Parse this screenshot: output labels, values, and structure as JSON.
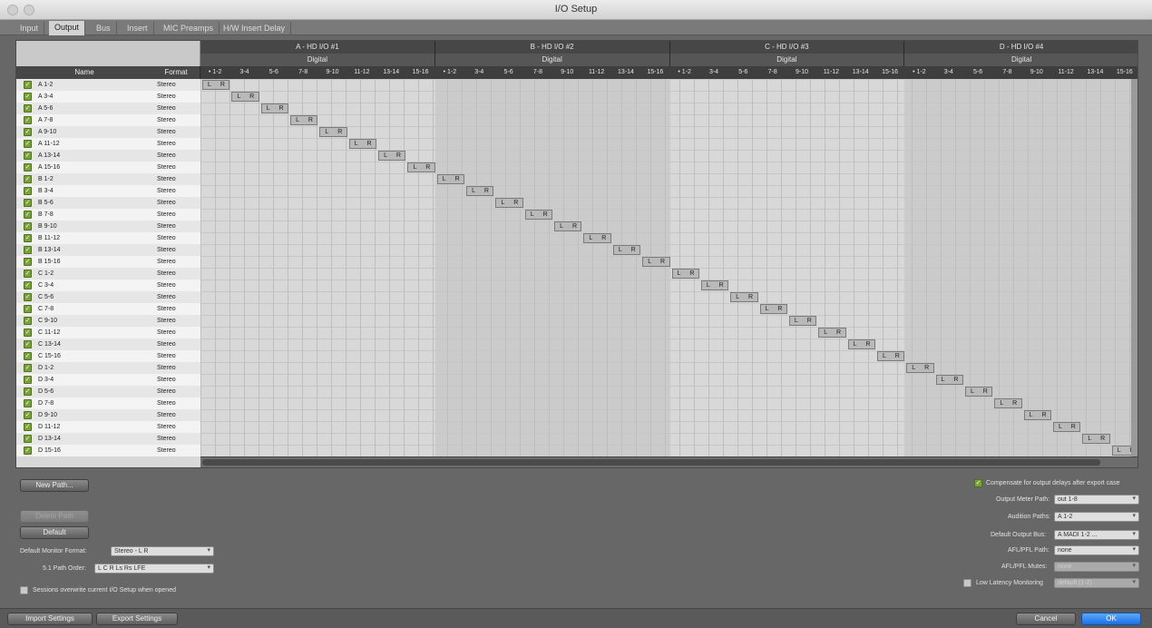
{
  "window": {
    "title": "I/O Setup"
  },
  "tabs": [
    {
      "label": "Input",
      "active": false
    },
    {
      "label": "Output",
      "active": true
    },
    {
      "label": "Bus",
      "active": false
    },
    {
      "label": "Insert",
      "active": false
    },
    {
      "label": "MIC Preamps",
      "active": false
    },
    {
      "label": "H/W Insert Delay",
      "active": false
    }
  ],
  "table": {
    "name_header": "Name",
    "format_header": "Format",
    "groups": [
      {
        "device": "A - HD I/O #1",
        "type": "Digital",
        "channels": [
          "• 1-2",
          "3-4",
          "5-6",
          "7-8",
          "9-10",
          "11-12",
          "13-14",
          "15-16"
        ]
      },
      {
        "device": "B - HD I/O #2",
        "type": "Digital",
        "channels": [
          "• 1-2",
          "3-4",
          "5-6",
          "7-8",
          "9-10",
          "11-12",
          "13-14",
          "15-16"
        ]
      },
      {
        "device": "C - HD I/O #3",
        "type": "Digital",
        "channels": [
          "• 1-2",
          "3-4",
          "5-6",
          "7-8",
          "9-10",
          "11-12",
          "13-14",
          "15-16"
        ]
      },
      {
        "device": "D - HD I/O #4",
        "type": "Digital",
        "channels": [
          "• 1-2",
          "3-4",
          "5-6",
          "7-8",
          "9-10",
          "11-12",
          "13-14",
          "15-16"
        ]
      }
    ],
    "rows": [
      {
        "name": "A 1-2",
        "format": "Stereo"
      },
      {
        "name": "A 3-4",
        "format": "Stereo"
      },
      {
        "name": "A 5-6",
        "format": "Stereo"
      },
      {
        "name": "A 7-8",
        "format": "Stereo"
      },
      {
        "name": "A 9-10",
        "format": "Stereo"
      },
      {
        "name": "A 11-12",
        "format": "Stereo"
      },
      {
        "name": "A 13-14",
        "format": "Stereo"
      },
      {
        "name": "A 15-16",
        "format": "Stereo"
      },
      {
        "name": "B 1-2",
        "format": "Stereo"
      },
      {
        "name": "B 3-4",
        "format": "Stereo"
      },
      {
        "name": "B 5-6",
        "format": "Stereo"
      },
      {
        "name": "B 7-8",
        "format": "Stereo"
      },
      {
        "name": "B 9-10",
        "format": "Stereo"
      },
      {
        "name": "B 11-12",
        "format": "Stereo"
      },
      {
        "name": "B 13-14",
        "format": "Stereo"
      },
      {
        "name": "B 15-16",
        "format": "Stereo"
      },
      {
        "name": "C 1-2",
        "format": "Stereo"
      },
      {
        "name": "C 3-4",
        "format": "Stereo"
      },
      {
        "name": "C 5-6",
        "format": "Stereo"
      },
      {
        "name": "C 7-8",
        "format": "Stereo"
      },
      {
        "name": "C 9-10",
        "format": "Stereo"
      },
      {
        "name": "C 11-12",
        "format": "Stereo"
      },
      {
        "name": "C 13-14",
        "format": "Stereo"
      },
      {
        "name": "C 15-16",
        "format": "Stereo"
      },
      {
        "name": "D 1-2",
        "format": "Stereo"
      },
      {
        "name": "D 3-4",
        "format": "Stereo"
      },
      {
        "name": "D 5-6",
        "format": "Stereo"
      },
      {
        "name": "D 7-8",
        "format": "Stereo"
      },
      {
        "name": "D 9-10",
        "format": "Stereo"
      },
      {
        "name": "D 11-12",
        "format": "Stereo"
      },
      {
        "name": "D 13-14",
        "format": "Stereo"
      },
      {
        "name": "D 15-16",
        "format": "Stereo"
      }
    ],
    "assign_left": "L",
    "assign_right": "R"
  },
  "left_controls": {
    "new_path": "New Path...",
    "delete_path": "Delete Path",
    "default": "Default",
    "monitor_format_label": "Default Monitor Format:",
    "monitor_format_value": "Stereo - L R",
    "path_order_label": "5.1 Path Order:",
    "path_order_value": "L C R Ls Rs LFE",
    "sessions_overwrite": "Sessions overwrite current I/O Setup when opened"
  },
  "right_controls": {
    "compensate": "Compensate for output delays after export case",
    "output_meter_label": "Output Meter Path:",
    "output_meter_value": "out 1-8",
    "audition_label": "Audition Paths:",
    "audition_value": "A 1-2",
    "default_bus_label": "Default Output Bus:",
    "default_bus_value": "A MADI 1-2 ...",
    "afl_path_label": "AFL/PFL Path:",
    "afl_path_value": "none",
    "afl_mutes_label": "AFL/PFL Mutes:",
    "afl_mutes_value": "none",
    "low_latency_label": "Low Latency Monitoring",
    "low_latency_value": "default (1-2)"
  },
  "bottom": {
    "import": "Import Settings",
    "export": "Export Settings",
    "cancel": "Cancel",
    "ok": "OK"
  }
}
